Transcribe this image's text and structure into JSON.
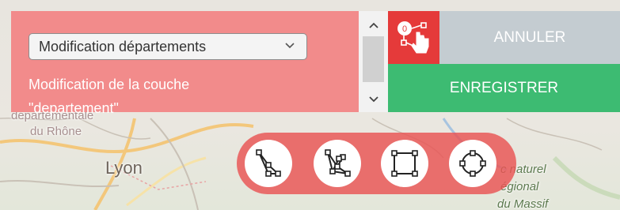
{
  "map": {
    "labels": {
      "departementale": "départementale",
      "du_rhone": "du Rhône",
      "lyon": "Lyon",
      "parc_line1": "c naturel",
      "parc_line2": "égional",
      "parc_line3": "du Massif"
    }
  },
  "panel": {
    "select_value": "Modification départements",
    "description_line1": "Modification de la couche",
    "description_line2": "\"departement\""
  },
  "actions": {
    "cancel_label": "ANNULER",
    "save_label": "ENREGISTRER",
    "counter_badge": "0"
  },
  "draw_tools": [
    {
      "name": "draw-polygon-icon"
    },
    {
      "name": "edit-vertices-icon"
    },
    {
      "name": "draw-rectangle-icon"
    },
    {
      "name": "draw-circle-icon"
    }
  ],
  "colors": {
    "panel": "#f28b8b",
    "accent_red": "#e53a3a",
    "cancel": "#c4ccd1",
    "save": "#3dbb72"
  }
}
